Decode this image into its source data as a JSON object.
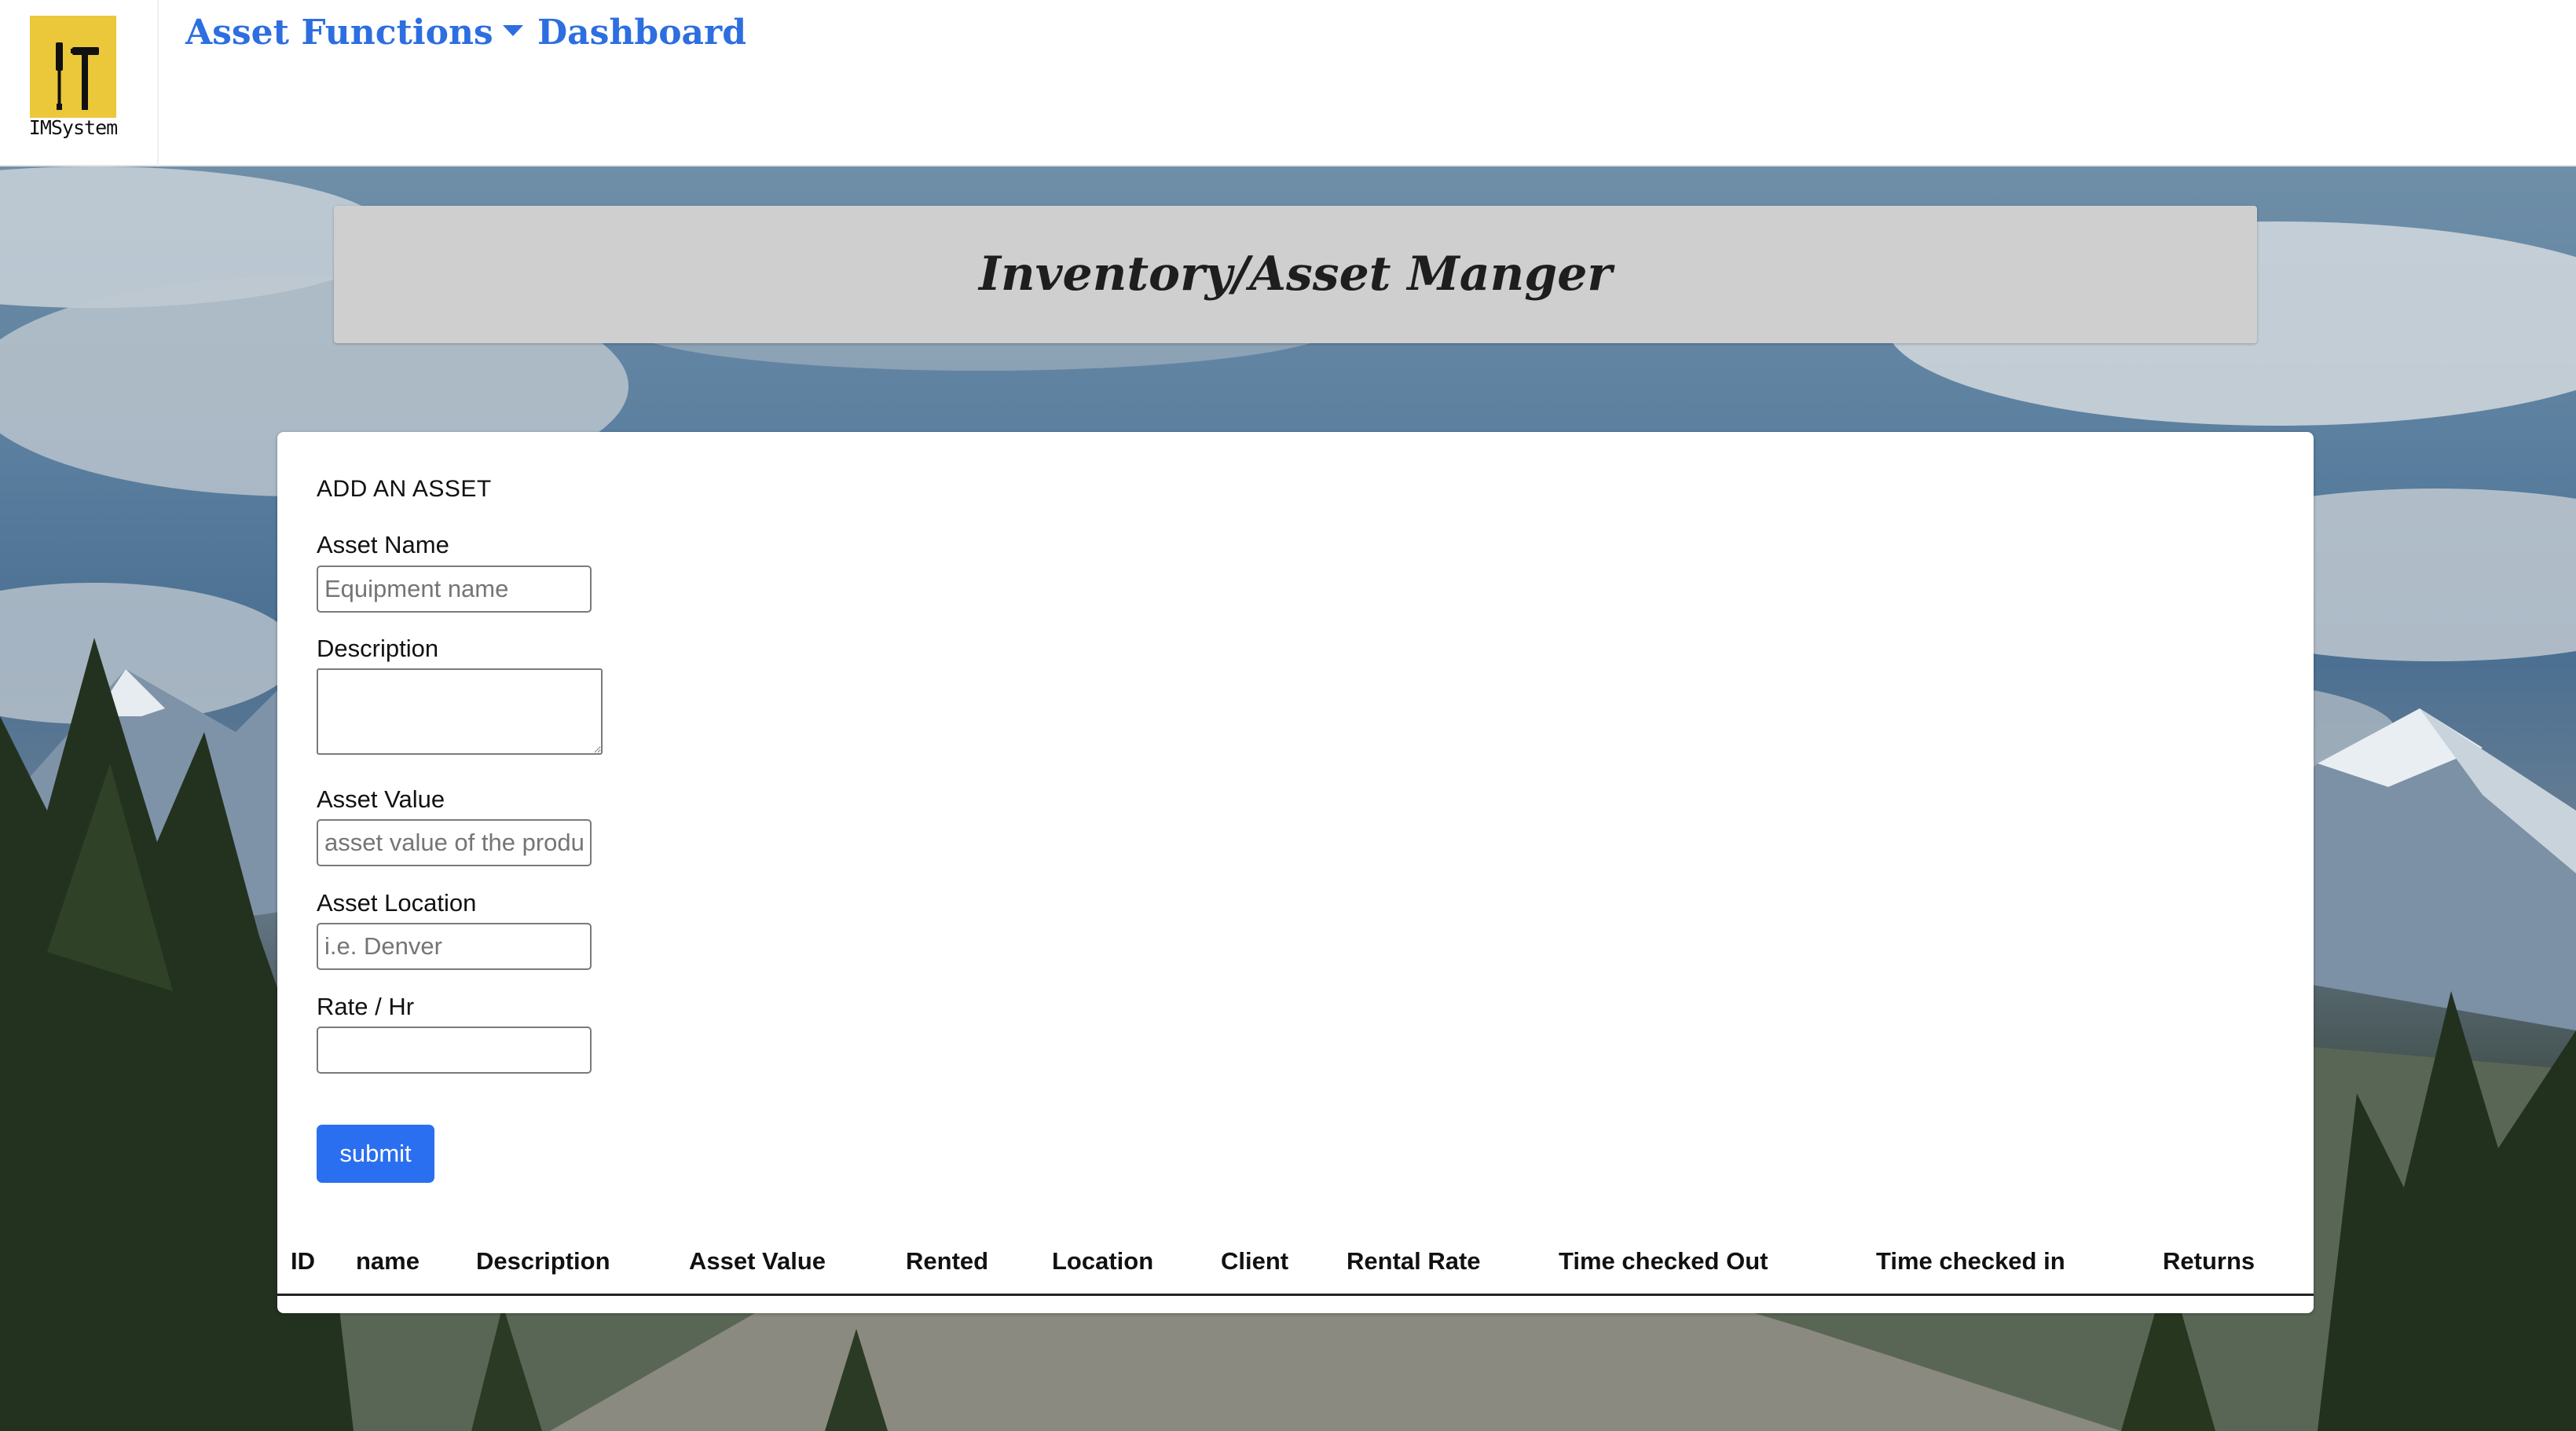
{
  "brand": {
    "logo_icon": "tools-icon",
    "name": "IMSystem"
  },
  "nav": {
    "asset_functions": "Asset Functions",
    "dashboard": "Dashboard",
    "link_color": "#2d6ee0"
  },
  "header": {
    "title": "Inventory/Asset Manger"
  },
  "form": {
    "heading": "ADD AN ASSET",
    "asset_name": {
      "label": "Asset Name",
      "placeholder": "Equipment name",
      "value": ""
    },
    "description": {
      "label": "Description",
      "value": ""
    },
    "asset_value": {
      "label": "Asset Value",
      "placeholder": "asset value of the product",
      "value": ""
    },
    "asset_location": {
      "label": "Asset Location",
      "placeholder": "i.e. Denver",
      "value": ""
    },
    "rate": {
      "label": "Rate / Hr",
      "placeholder": "",
      "value": ""
    },
    "submit_label": "submit",
    "submit_color": "#2b6ff1"
  },
  "table": {
    "columns": [
      "ID",
      "name",
      "Description",
      "Asset Value",
      "Rented",
      "Location",
      "Client",
      "Rental Rate",
      "Time checked Out",
      "Time checked in",
      "Returns"
    ],
    "rows": []
  },
  "colors": {
    "logo_bg": "#eac83a",
    "header_bg": "#cfcfcf"
  }
}
